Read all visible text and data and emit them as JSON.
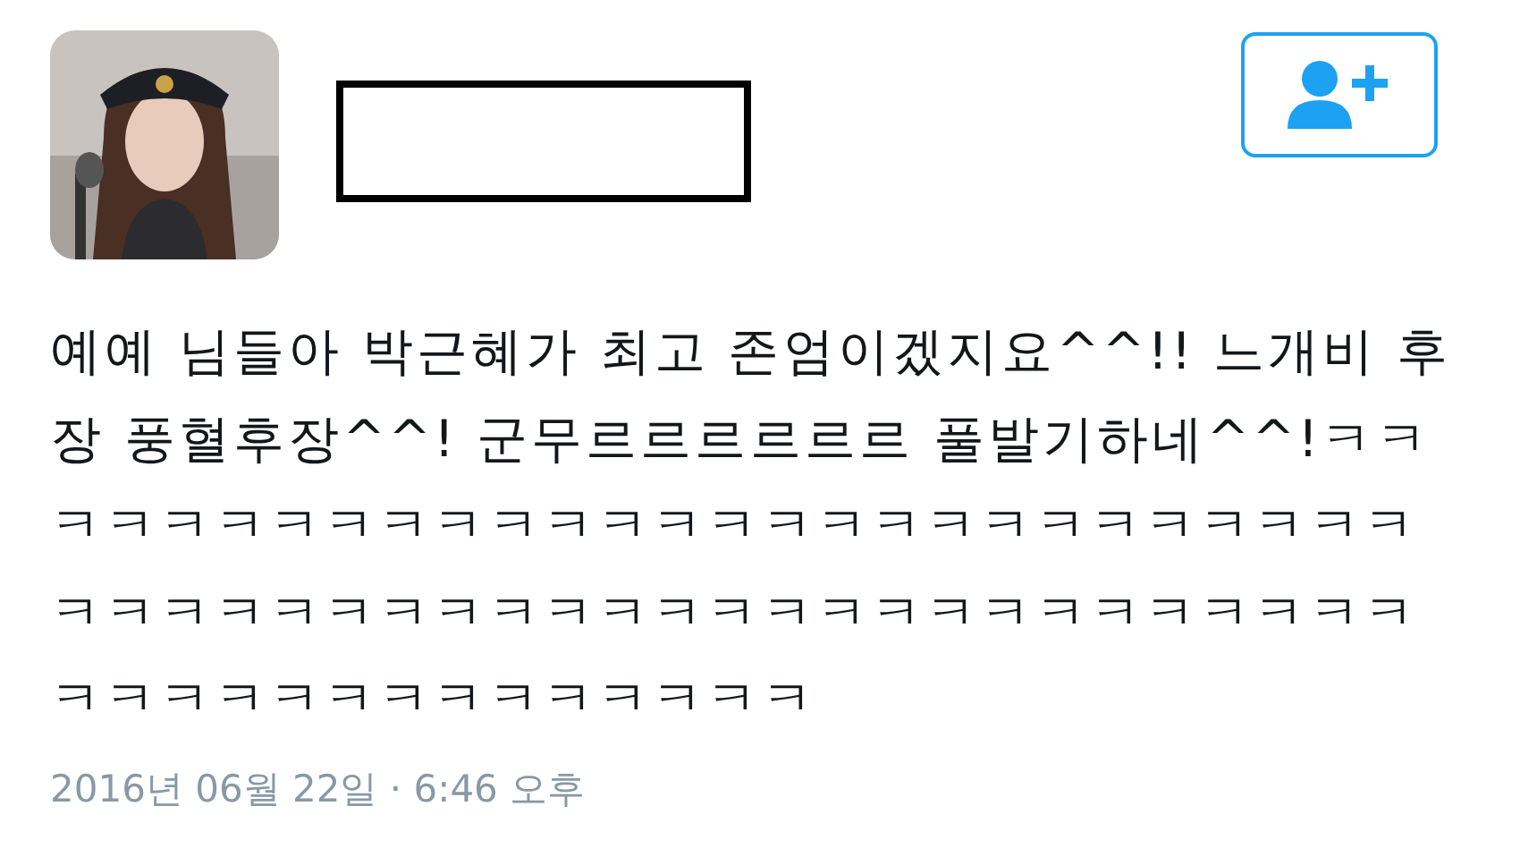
{
  "tweet": {
    "text": "예예 님들아 박근혜가 최고 존엄이겠지요^^!! 느개비 후장 풍혈후장^^! 군무르르르르르르 풀발기하네^^!ㅋㅋㅋㅋㅋㅋㅋㅋㅋㅋㅋㅋㅋㅋㅋㅋㅋㅋㅋㅋㅋㅋㅋㅋㅋㅋㅋㅋㅋㅋㅋㅋㅋㅋㅋㅋㅋㅋㅋㅋㅋㅋㅋㅋㅋㅋㅋㅋㅋㅋㅋㅋㅋㅋㅋㅋㅋㅋㅋㅋㅋㅋㅋㅋㅋㅋ",
    "timestamp": "2016년 06월 22일 · 6:46 오후"
  }
}
